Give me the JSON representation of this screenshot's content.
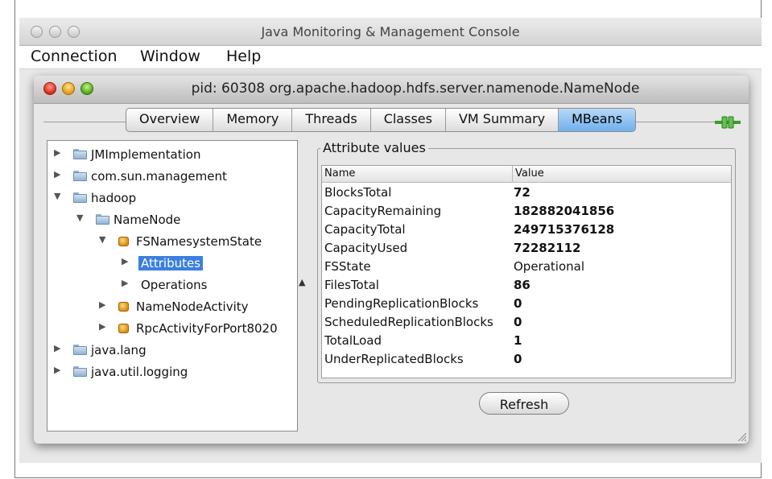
{
  "outer_window": {
    "title": "Java Monitoring & Management Console"
  },
  "menu": {
    "items": [
      "Connection",
      "Window",
      "Help"
    ]
  },
  "inner_window": {
    "title": "pid: 60308 org.apache.hadoop.hdfs.server.namenode.NameNode"
  },
  "tabs": [
    "Overview",
    "Memory",
    "Threads",
    "Classes",
    "VM Summary",
    "MBeans"
  ],
  "active_tab": "MBeans",
  "tree": {
    "items": [
      {
        "label": "JMImplementation",
        "icon": "folder-icon",
        "expanded": false
      },
      {
        "label": "com.sun.management",
        "icon": "folder-icon",
        "expanded": false
      },
      {
        "label": "hadoop",
        "icon": "folder-icon",
        "expanded": true
      },
      {
        "label": "NameNode",
        "icon": "folder-icon",
        "expanded": true
      },
      {
        "label": "FSNamesystemState",
        "icon": "bean-icon",
        "expanded": true
      },
      {
        "label": "Attributes",
        "icon": "none",
        "expanded": false,
        "selected": true
      },
      {
        "label": "Operations",
        "icon": "none",
        "expanded": false
      },
      {
        "label": "NameNodeActivity",
        "icon": "bean-icon",
        "expanded": false
      },
      {
        "label": "RpcActivityForPort8020",
        "icon": "bean-icon",
        "expanded": false
      },
      {
        "label": "java.lang",
        "icon": "folder-icon",
        "expanded": false
      },
      {
        "label": "java.util.logging",
        "icon": "folder-icon",
        "expanded": false
      }
    ]
  },
  "attributes": {
    "group_title": "Attribute values",
    "columns": {
      "name": "Name",
      "value": "Value"
    },
    "rows": [
      {
        "name": "BlocksTotal",
        "value": "72"
      },
      {
        "name": "CapacityRemaining",
        "value": "182882041856"
      },
      {
        "name": "CapacityTotal",
        "value": "249715376128"
      },
      {
        "name": "CapacityUsed",
        "value": "72282112"
      },
      {
        "name": "FSState",
        "value": "Operational"
      },
      {
        "name": "FilesTotal",
        "value": "86"
      },
      {
        "name": "PendingReplicationBlocks",
        "value": "0"
      },
      {
        "name": "ScheduledReplicationBlocks",
        "value": "0"
      },
      {
        "name": "TotalLoad",
        "value": "1"
      },
      {
        "name": "UnderReplicatedBlocks",
        "value": "0"
      }
    ]
  },
  "refresh_button": {
    "label": "Refresh"
  },
  "colors": {
    "selection": "#3b7fe0",
    "active_tab": "#6fb0ee"
  }
}
